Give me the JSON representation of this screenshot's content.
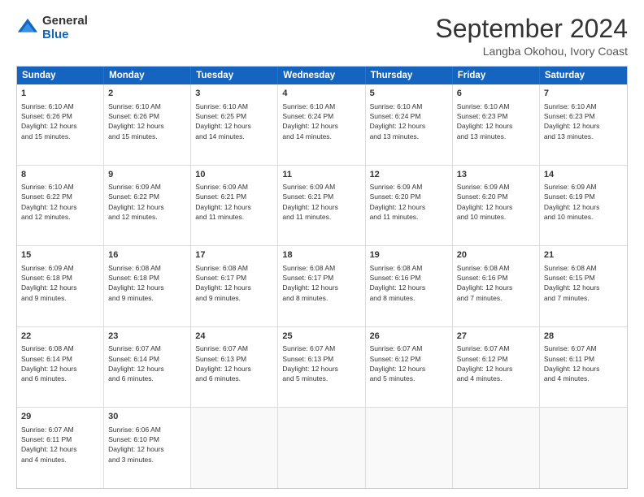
{
  "logo": {
    "general": "General",
    "blue": "Blue"
  },
  "title": "September 2024",
  "subtitle": "Langba Okohou, Ivory Coast",
  "header_days": [
    "Sunday",
    "Monday",
    "Tuesday",
    "Wednesday",
    "Thursday",
    "Friday",
    "Saturday"
  ],
  "rows": [
    [
      {
        "day": "1",
        "lines": [
          "Sunrise: 6:10 AM",
          "Sunset: 6:26 PM",
          "Daylight: 12 hours",
          "and 15 minutes."
        ]
      },
      {
        "day": "2",
        "lines": [
          "Sunrise: 6:10 AM",
          "Sunset: 6:26 PM",
          "Daylight: 12 hours",
          "and 15 minutes."
        ]
      },
      {
        "day": "3",
        "lines": [
          "Sunrise: 6:10 AM",
          "Sunset: 6:25 PM",
          "Daylight: 12 hours",
          "and 14 minutes."
        ]
      },
      {
        "day": "4",
        "lines": [
          "Sunrise: 6:10 AM",
          "Sunset: 6:24 PM",
          "Daylight: 12 hours",
          "and 14 minutes."
        ]
      },
      {
        "day": "5",
        "lines": [
          "Sunrise: 6:10 AM",
          "Sunset: 6:24 PM",
          "Daylight: 12 hours",
          "and 13 minutes."
        ]
      },
      {
        "day": "6",
        "lines": [
          "Sunrise: 6:10 AM",
          "Sunset: 6:23 PM",
          "Daylight: 12 hours",
          "and 13 minutes."
        ]
      },
      {
        "day": "7",
        "lines": [
          "Sunrise: 6:10 AM",
          "Sunset: 6:23 PM",
          "Daylight: 12 hours",
          "and 13 minutes."
        ]
      }
    ],
    [
      {
        "day": "8",
        "lines": [
          "Sunrise: 6:10 AM",
          "Sunset: 6:22 PM",
          "Daylight: 12 hours",
          "and 12 minutes."
        ]
      },
      {
        "day": "9",
        "lines": [
          "Sunrise: 6:09 AM",
          "Sunset: 6:22 PM",
          "Daylight: 12 hours",
          "and 12 minutes."
        ]
      },
      {
        "day": "10",
        "lines": [
          "Sunrise: 6:09 AM",
          "Sunset: 6:21 PM",
          "Daylight: 12 hours",
          "and 11 minutes."
        ]
      },
      {
        "day": "11",
        "lines": [
          "Sunrise: 6:09 AM",
          "Sunset: 6:21 PM",
          "Daylight: 12 hours",
          "and 11 minutes."
        ]
      },
      {
        "day": "12",
        "lines": [
          "Sunrise: 6:09 AM",
          "Sunset: 6:20 PM",
          "Daylight: 12 hours",
          "and 11 minutes."
        ]
      },
      {
        "day": "13",
        "lines": [
          "Sunrise: 6:09 AM",
          "Sunset: 6:20 PM",
          "Daylight: 12 hours",
          "and 10 minutes."
        ]
      },
      {
        "day": "14",
        "lines": [
          "Sunrise: 6:09 AM",
          "Sunset: 6:19 PM",
          "Daylight: 12 hours",
          "and 10 minutes."
        ]
      }
    ],
    [
      {
        "day": "15",
        "lines": [
          "Sunrise: 6:09 AM",
          "Sunset: 6:18 PM",
          "Daylight: 12 hours",
          "and 9 minutes."
        ]
      },
      {
        "day": "16",
        "lines": [
          "Sunrise: 6:08 AM",
          "Sunset: 6:18 PM",
          "Daylight: 12 hours",
          "and 9 minutes."
        ]
      },
      {
        "day": "17",
        "lines": [
          "Sunrise: 6:08 AM",
          "Sunset: 6:17 PM",
          "Daylight: 12 hours",
          "and 9 minutes."
        ]
      },
      {
        "day": "18",
        "lines": [
          "Sunrise: 6:08 AM",
          "Sunset: 6:17 PM",
          "Daylight: 12 hours",
          "and 8 minutes."
        ]
      },
      {
        "day": "19",
        "lines": [
          "Sunrise: 6:08 AM",
          "Sunset: 6:16 PM",
          "Daylight: 12 hours",
          "and 8 minutes."
        ]
      },
      {
        "day": "20",
        "lines": [
          "Sunrise: 6:08 AM",
          "Sunset: 6:16 PM",
          "Daylight: 12 hours",
          "and 7 minutes."
        ]
      },
      {
        "day": "21",
        "lines": [
          "Sunrise: 6:08 AM",
          "Sunset: 6:15 PM",
          "Daylight: 12 hours",
          "and 7 minutes."
        ]
      }
    ],
    [
      {
        "day": "22",
        "lines": [
          "Sunrise: 6:08 AM",
          "Sunset: 6:14 PM",
          "Daylight: 12 hours",
          "and 6 minutes."
        ]
      },
      {
        "day": "23",
        "lines": [
          "Sunrise: 6:07 AM",
          "Sunset: 6:14 PM",
          "Daylight: 12 hours",
          "and 6 minutes."
        ]
      },
      {
        "day": "24",
        "lines": [
          "Sunrise: 6:07 AM",
          "Sunset: 6:13 PM",
          "Daylight: 12 hours",
          "and 6 minutes."
        ]
      },
      {
        "day": "25",
        "lines": [
          "Sunrise: 6:07 AM",
          "Sunset: 6:13 PM",
          "Daylight: 12 hours",
          "and 5 minutes."
        ]
      },
      {
        "day": "26",
        "lines": [
          "Sunrise: 6:07 AM",
          "Sunset: 6:12 PM",
          "Daylight: 12 hours",
          "and 5 minutes."
        ]
      },
      {
        "day": "27",
        "lines": [
          "Sunrise: 6:07 AM",
          "Sunset: 6:12 PM",
          "Daylight: 12 hours",
          "and 4 minutes."
        ]
      },
      {
        "day": "28",
        "lines": [
          "Sunrise: 6:07 AM",
          "Sunset: 6:11 PM",
          "Daylight: 12 hours",
          "and 4 minutes."
        ]
      }
    ],
    [
      {
        "day": "29",
        "lines": [
          "Sunrise: 6:07 AM",
          "Sunset: 6:11 PM",
          "Daylight: 12 hours",
          "and 4 minutes."
        ]
      },
      {
        "day": "30",
        "lines": [
          "Sunrise: 6:06 AM",
          "Sunset: 6:10 PM",
          "Daylight: 12 hours",
          "and 3 minutes."
        ]
      },
      {
        "day": "",
        "lines": []
      },
      {
        "day": "",
        "lines": []
      },
      {
        "day": "",
        "lines": []
      },
      {
        "day": "",
        "lines": []
      },
      {
        "day": "",
        "lines": []
      }
    ]
  ]
}
